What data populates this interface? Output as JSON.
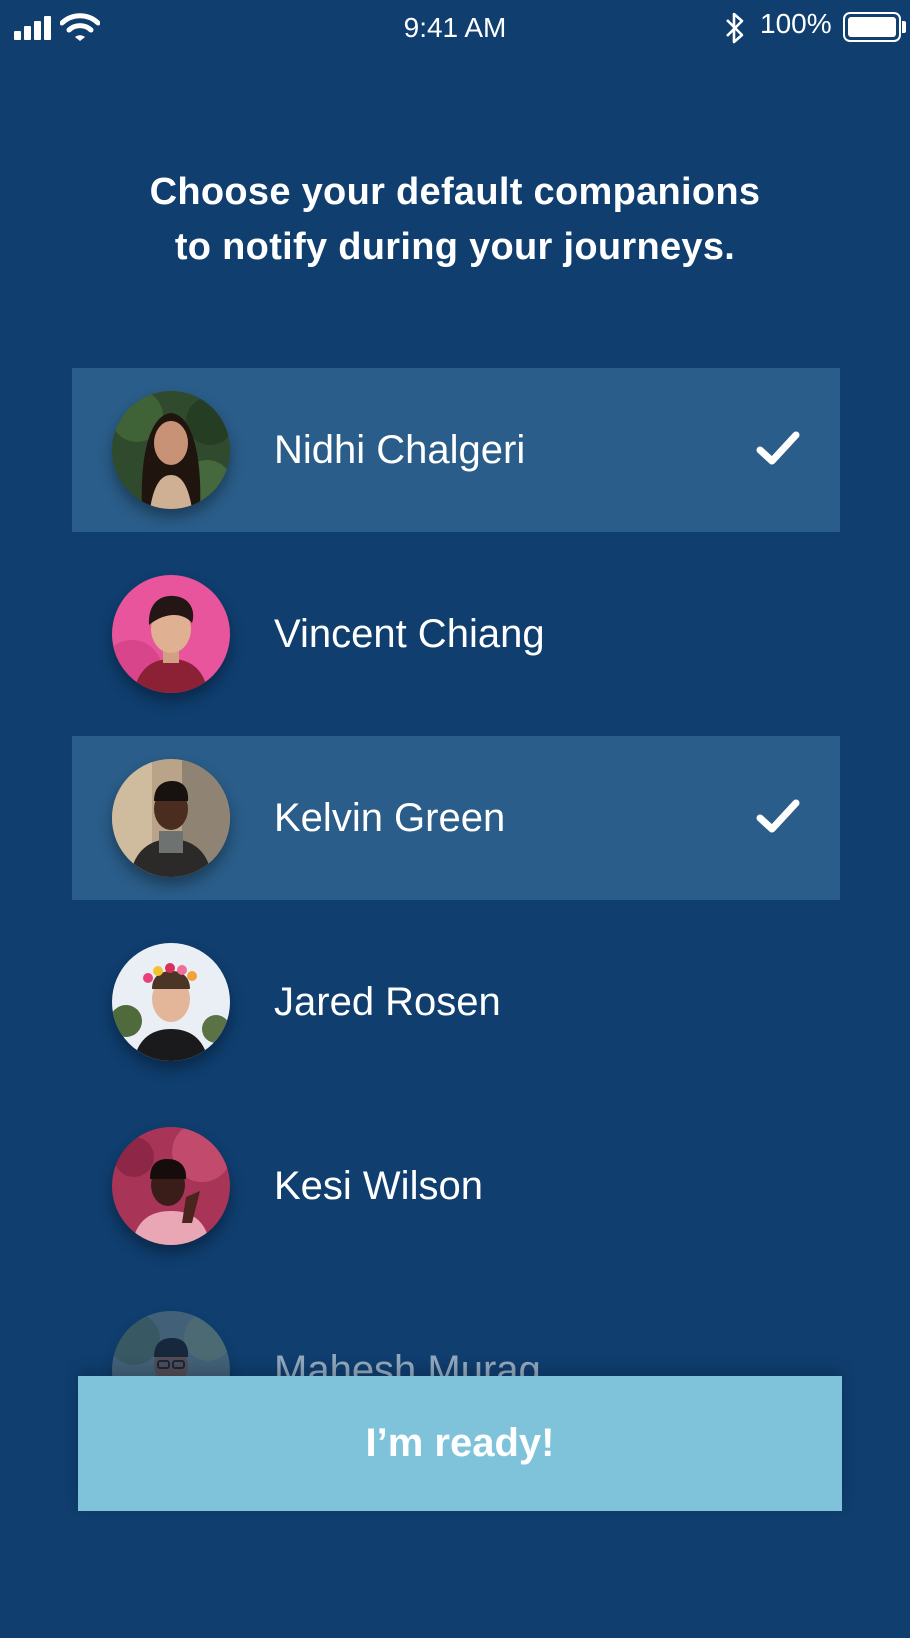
{
  "status_bar": {
    "time": "9:41 AM",
    "battery": "100%",
    "icons": [
      "signal-icon",
      "wifi-icon",
      "bluetooth-icon",
      "battery-icon"
    ]
  },
  "heading": {
    "line1": "Choose your default companions",
    "line2": "to notify during your journeys."
  },
  "companions": [
    {
      "name": "Nidhi Chalgeri",
      "selected": true
    },
    {
      "name": "Vincent Chiang",
      "selected": false
    },
    {
      "name": "Kelvin Green",
      "selected": true
    },
    {
      "name": "Jared Rosen",
      "selected": false
    },
    {
      "name": "Kesi Wilson",
      "selected": false
    },
    {
      "name": "Mahesh Murag",
      "selected": false
    }
  ],
  "cta": {
    "label": "I’m ready!"
  },
  "colors": {
    "background": "#0f3e6f",
    "selected_row": "#2a5d89",
    "button": "#7fc3da",
    "text": "#ffffff"
  }
}
